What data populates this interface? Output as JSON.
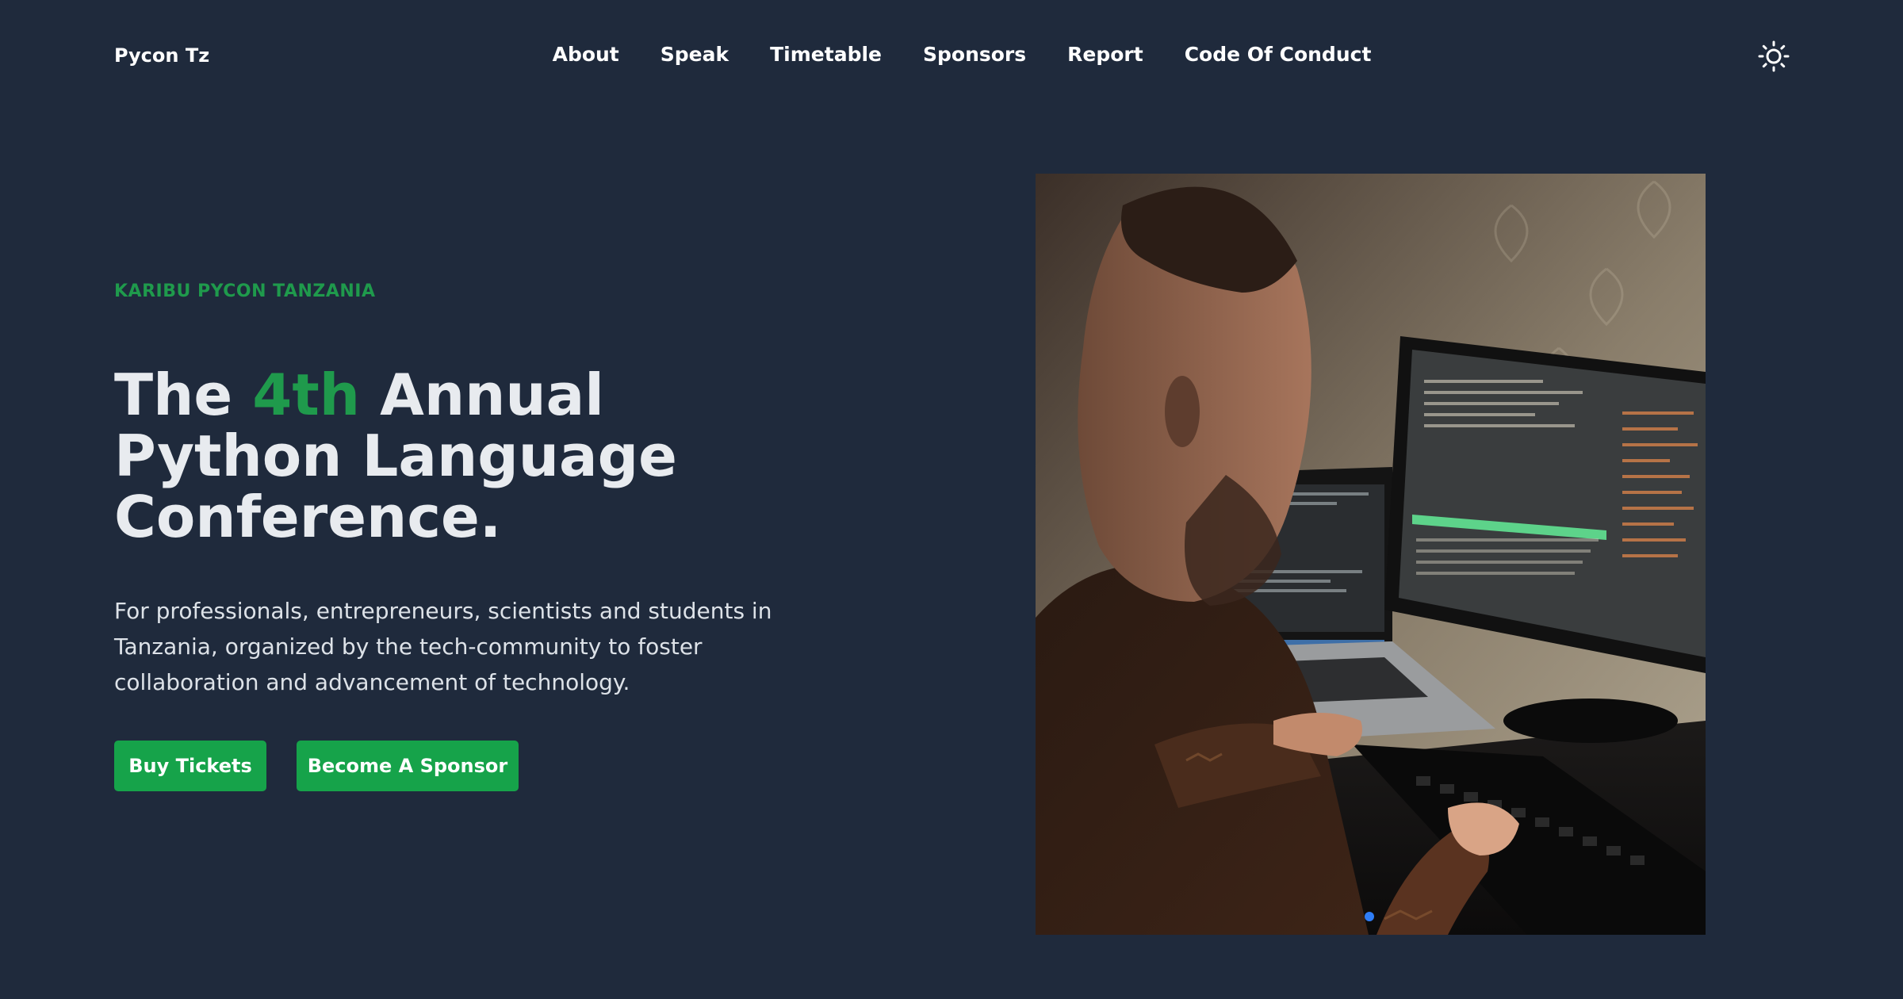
{
  "header": {
    "brand": "Pycon Tz",
    "nav": [
      "About",
      "Speak",
      "Timetable",
      "Sponsors",
      "Report",
      "Code Of Conduct"
    ],
    "theme_icon": "sun-icon"
  },
  "hero": {
    "eyebrow": "KARIBU PYCON TANZANIA",
    "headline_pre": "The ",
    "headline_accent": "4th",
    "headline_line1_rest": " Annual",
    "headline_line2": "Python Language",
    "headline_line3": "Conference.",
    "description": "For professionals, entrepreneurs, scientists and students in Tanzania, organized by the tech-community to foster collaboration and advancement of technology.",
    "buttons": {
      "tickets": "Buy Tickets",
      "sponsor": "Become A Sponsor"
    },
    "carousel": {
      "active_slide": 1
    }
  },
  "colors": {
    "background": "#1f2a3c",
    "accent": "#1f9a4c",
    "button": "#16a34a",
    "dot": "#2f7df6"
  }
}
